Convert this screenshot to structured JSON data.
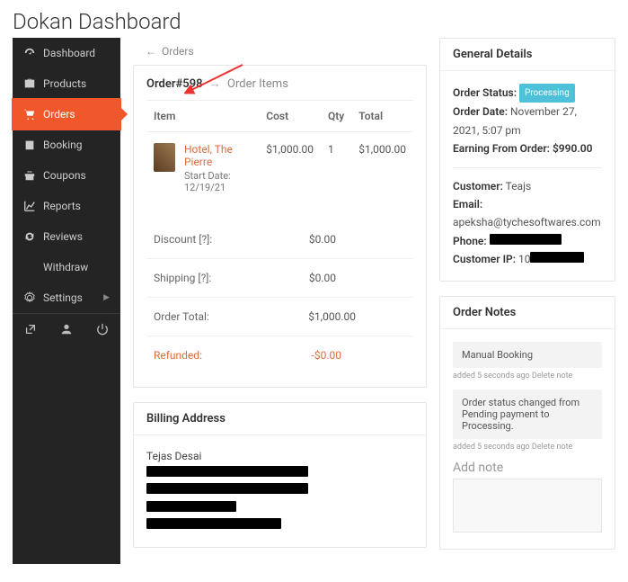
{
  "page": {
    "title": "Dokan Dashboard"
  },
  "sidebar": {
    "items": [
      {
        "key": "dashboard",
        "label": "Dashboard"
      },
      {
        "key": "products",
        "label": "Products"
      },
      {
        "key": "orders",
        "label": "Orders"
      },
      {
        "key": "booking",
        "label": "Booking"
      },
      {
        "key": "coupons",
        "label": "Coupons"
      },
      {
        "key": "reports",
        "label": "Reports"
      },
      {
        "key": "reviews",
        "label": "Reviews"
      },
      {
        "key": "withdraw",
        "label": "Withdraw"
      },
      {
        "key": "settings",
        "label": "Settings"
      }
    ]
  },
  "nav": {
    "back": "Orders"
  },
  "breadcrumb": {
    "order": "Order#598",
    "section": "Order Items"
  },
  "items_table": {
    "headers": {
      "item": "Item",
      "cost": "Cost",
      "qty": "Qty",
      "total": "Total"
    },
    "rows": [
      {
        "name": "Hotel, The Pierre",
        "subtitle": "Start Date: 12/19/21",
        "cost": "$1,000.00",
        "qty": "1",
        "total": "$1,000.00"
      }
    ]
  },
  "totals": {
    "discount": {
      "label": "Discount [?]:",
      "value": "$0.00"
    },
    "shipping": {
      "label": "Shipping [?]:",
      "value": "$0.00"
    },
    "order_total": {
      "label": "Order Total:",
      "value": "$1,000.00"
    },
    "refunded": {
      "label": "Refunded:",
      "value": "-$0.00"
    }
  },
  "general": {
    "title": "General Details",
    "status_label": "Order Status:",
    "status_value": "Processing",
    "date_label": "Order Date:",
    "date_value": "November 27, 2021, 5:07 pm",
    "earning_label": "Earning From Order:",
    "earning_value": "$990.00",
    "customer_label": "Customer:",
    "customer_value": "Teajs",
    "email_label": "Email:",
    "email_value": "apeksha@tychesoftwares.com",
    "phone_label": "Phone:",
    "ip_label": "Customer IP:",
    "ip_prefix": "10"
  },
  "notes": {
    "title": "Order Notes",
    "entries": [
      {
        "text": "Manual Booking",
        "meta_time": "added 5 seconds ago",
        "delete": "Delete note"
      },
      {
        "text": "Order status changed from Pending payment to Processing.",
        "meta_time": "added 5 seconds ago",
        "delete": "Delete note"
      }
    ],
    "add_label": "Add note"
  },
  "billing": {
    "title": "Billing Address",
    "name": "Tejas Desai"
  }
}
